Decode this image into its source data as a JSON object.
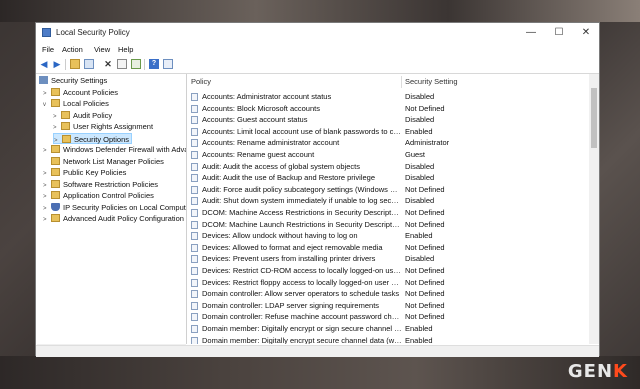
{
  "window": {
    "title": "Local Security Policy"
  },
  "window_controls": {
    "minimize": "—",
    "maximize": "☐",
    "close": "✕"
  },
  "menu": [
    "File",
    "Action",
    "View",
    "Help"
  ],
  "tree": {
    "root": "Security Settings",
    "items": [
      "Account Policies",
      "Local Policies",
      "Audit Policy",
      "User Rights Assignment",
      "Security Options",
      "Windows Defender Firewall with Adva",
      "Network List Manager Policies",
      "Public Key Policies",
      "Software Restriction Policies",
      "Application Control Policies",
      "IP Security Policies on Local Compute",
      "Advanced Audit Policy Configuration"
    ]
  },
  "list": {
    "columns": {
      "policy": "Policy",
      "setting": "Security Setting"
    },
    "rows": [
      {
        "policy": "Accounts: Administrator account status",
        "setting": "Disabled"
      },
      {
        "policy": "Accounts: Block Microsoft accounts",
        "setting": "Not Defined"
      },
      {
        "policy": "Accounts: Guest account status",
        "setting": "Disabled"
      },
      {
        "policy": "Accounts: Limit local account use of blank passwords to co...",
        "setting": "Enabled"
      },
      {
        "policy": "Accounts: Rename administrator account",
        "setting": "Administrator"
      },
      {
        "policy": "Accounts: Rename guest account",
        "setting": "Guest"
      },
      {
        "policy": "Audit: Audit the access of global system objects",
        "setting": "Disabled"
      },
      {
        "policy": "Audit: Audit the use of Backup and Restore privilege",
        "setting": "Disabled"
      },
      {
        "policy": "Audit: Force audit policy subcategory settings (Windows Vis...",
        "setting": "Not Defined"
      },
      {
        "policy": "Audit: Shut down system immediately if unable to log secur...",
        "setting": "Disabled"
      },
      {
        "policy": "DCOM: Machine Access Restrictions in Security Descriptor D...",
        "setting": "Not Defined"
      },
      {
        "policy": "DCOM: Machine Launch Restrictions in Security Descriptor ...",
        "setting": "Not Defined"
      },
      {
        "policy": "Devices: Allow undock without having to log on",
        "setting": "Enabled"
      },
      {
        "policy": "Devices: Allowed to format and eject removable media",
        "setting": "Not Defined"
      },
      {
        "policy": "Devices: Prevent users from installing printer drivers",
        "setting": "Disabled"
      },
      {
        "policy": "Devices: Restrict CD-ROM access to locally logged-on user ...",
        "setting": "Not Defined"
      },
      {
        "policy": "Devices: Restrict floppy access to locally logged-on user only",
        "setting": "Not Defined"
      },
      {
        "policy": "Domain controller: Allow server operators to schedule tasks",
        "setting": "Not Defined"
      },
      {
        "policy": "Domain controller: LDAP server signing requirements",
        "setting": "Not Defined"
      },
      {
        "policy": "Domain controller: Refuse machine account password chan...",
        "setting": "Not Defined"
      },
      {
        "policy": "Domain member: Digitally encrypt or sign secure channel d...",
        "setting": "Enabled"
      },
      {
        "policy": "Domain member: Digitally encrypt secure channel data (whe...",
        "setting": "Enabled"
      },
      {
        "policy": "Domain member: Digitally sign secure channel data (when ...",
        "setting": "Enabled"
      }
    ]
  },
  "watermark": {
    "prefix": "GEN",
    "suffix": "K"
  }
}
